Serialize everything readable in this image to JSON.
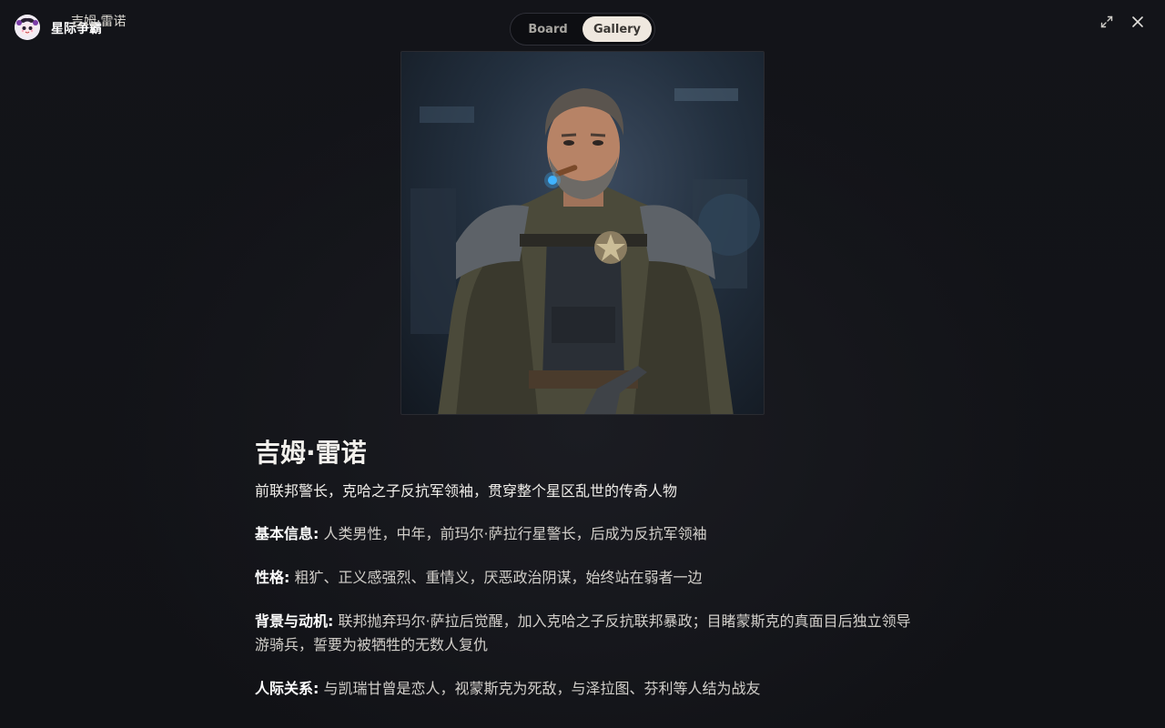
{
  "brand": {
    "name": "星际争霸",
    "sub": "吉姆·雷诺"
  },
  "view_toggle": {
    "options": [
      "Board",
      "Gallery"
    ],
    "active": "Gallery"
  },
  "icons": {
    "logo": "mascot-logo-icon",
    "fullscreen": "expand-icon",
    "close": "close-icon"
  },
  "portrait": {
    "subject": "character-portrait"
  },
  "character": {
    "name": "吉姆·雷诺",
    "tagline": "前联邦警长，克哈之子反抗军领袖，贯穿整个星区乱世的传奇人物",
    "fields": [
      {
        "label": "基本信息:",
        "value": "人类男性，中年，前玛尔·萨拉行星警长，后成为反抗军领袖"
      },
      {
        "label": "性格:",
        "value": "粗犷、正义感强烈、重情义，厌恶政治阴谋，始终站在弱者一边"
      },
      {
        "label": "背景与动机:",
        "value": "联邦抛弃玛尔·萨拉后觉醒，加入克哈之子反抗联邦暴政；目睹蒙斯克的真面目后独立领导游骑兵，誓要为被牺牲的无数人复仇"
      },
      {
        "label": "人际关系:",
        "value": "与凯瑞甘曾是恋人，视蒙斯克为死敌，与泽拉图、芬利等人结为战友"
      }
    ]
  },
  "colors": {
    "background": "#121318",
    "toggle_active_bg": "#efe8df",
    "text_primary": "#f2f0ec"
  }
}
